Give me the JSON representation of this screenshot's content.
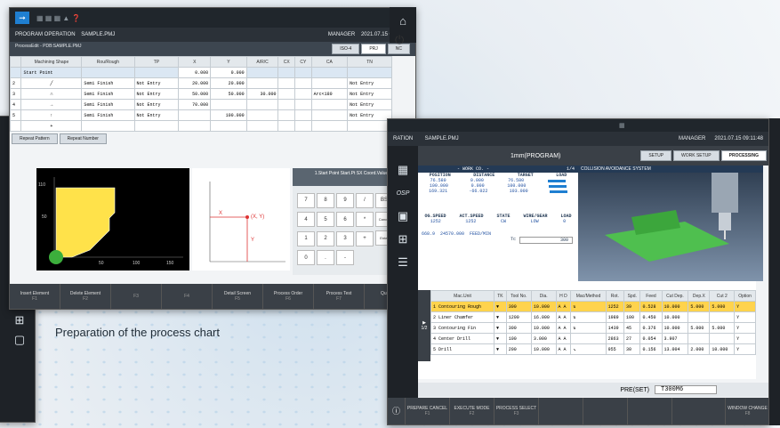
{
  "caption": "Preparation of the process chart",
  "win1": {
    "title": "PROGRAM OPERATION",
    "file": "SAMPLE.PMJ",
    "user": "MANAGER",
    "datetime": "2021.07.15 08:42:37",
    "process_label": "ProcessEdit - PDB:SAMPLE.PMJ",
    "tabs": [
      "ISO-4",
      "PRJ",
      "NC"
    ],
    "headers": [
      "Machining Shape",
      "Rou/Rough",
      "TP",
      "X",
      "Y",
      "A/R/C",
      "CX",
      "CY",
      "CA",
      "TN"
    ],
    "rows": [
      {
        "no": "",
        "shape": "Start Point",
        "rough": "",
        "tp": "",
        "x": "0.000",
        "y": "0.000",
        "a": "",
        "cx": "",
        "cy": "",
        "ca": "",
        "tn": ""
      },
      {
        "no": "2",
        "shape": "",
        "rough": "Semi Finish",
        "tp": "Not Entry",
        "x": "20.000",
        "y": "20.000",
        "a": "",
        "cx": "",
        "cy": "",
        "ca": "",
        "tn": "Not Entry"
      },
      {
        "no": "3",
        "shape": "",
        "rough": "Semi Finish",
        "tp": "Not Entry",
        "x": "50.000",
        "y": "50.000",
        "a": "30.000",
        "cx": "",
        "cy": "",
        "ca": "Arc<180",
        "tn": "Not Entry"
      },
      {
        "no": "4",
        "shape": "",
        "rough": "Semi Finish",
        "tp": "Not Entry",
        "x": "70.000",
        "y": "",
        "a": "",
        "cx": "",
        "cy": "",
        "ca": "",
        "tn": "Not Entry"
      },
      {
        "no": "5",
        "shape": "",
        "rough": "Semi Finish",
        "tp": "Not Entry",
        "x": "",
        "y": "100.000",
        "a": "",
        "cx": "",
        "cy": "",
        "ca": "",
        "tn": "Not Entry"
      }
    ],
    "repeat": [
      "Repeat Pattern",
      "Repeat Number"
    ],
    "axis_y": [
      "110",
      "50"
    ],
    "axis_x": [
      "50",
      "100",
      "150"
    ],
    "diagram": {
      "x": "X",
      "y": "Y",
      "xy": "(X, Y)"
    },
    "keypad_title": "1.Start Point Start.Pt SX Coord.Value",
    "keys": [
      "7",
      "8",
      "9",
      "/",
      "BS",
      "4",
      "5",
      "6",
      "*",
      "Cancel",
      "1",
      "2",
      "3",
      "+",
      "Enter",
      "0",
      ".",
      "-"
    ],
    "fkeys": [
      "Insert Element",
      "Delete Element",
      "",
      "",
      "Detail Screen",
      "Process Order",
      "Process Test",
      "Quit/Save"
    ],
    "fnums": [
      "F1",
      "F2",
      "F3",
      "F4",
      "F5",
      "F6",
      "F7",
      "F8"
    ]
  },
  "win2": {
    "title": "RATION",
    "file": "SAMPLE.PMJ",
    "user": "MANAGER",
    "datetime": "2021.07.15 09:11:48",
    "program": "1mm(PROGRAM)",
    "tabs": [
      "SETUP",
      "WORK SETUP",
      "PROCESSING"
    ],
    "work_co": "- WORK CO. -",
    "page": "1/4",
    "pos_headers": [
      "POSITION",
      "DISTANCE",
      "TARGET",
      "LOAD"
    ],
    "pos_rows": [
      [
        "76.580",
        "0.000",
        "76.580"
      ],
      [
        "100.000",
        "0.000",
        "100.000"
      ],
      [
        "169.321",
        "-66.022",
        "103.000"
      ]
    ],
    "spd_headers": [
      "OG.SPEED",
      "ACT.SPEED",
      "STATE",
      "WIRE/GEAR",
      "LOAD"
    ],
    "spd_row": [
      "1252",
      "1252",
      "CW",
      "LOW",
      "0"
    ],
    "feed": "668.9",
    "feed2": "24570.000",
    "feed_label": "FEED/MIN",
    "tc": "Tc",
    "tc_val": "300",
    "collision": "COLLISION AVOIDANCE SYSTEM",
    "tbl_headers": [
      "Mac.Unit",
      "TK",
      "Tool No.",
      "Dia.",
      "H D",
      "Mac/Method",
      "Rot.",
      "Spd.",
      "Feed",
      "Cut Dep.",
      "Dep.X",
      "Cut 1",
      "Dep.Z",
      "Cut 2",
      "Option"
    ],
    "tbl_rows": [
      [
        "1 Contouring Rough",
        "",
        "300",
        "10.000",
        "A A",
        "",
        "1252",
        "39",
        "0.528",
        "10.000",
        "5.000",
        "5.000"
      ],
      [
        "2 Liner Chamfer",
        "",
        "1200",
        "16.000",
        "A A",
        "",
        "1989",
        "100",
        "0.450",
        "10.000",
        "",
        ""
      ],
      [
        "3 Contouring Fin",
        "",
        "300",
        "10.000",
        "A A",
        "",
        "1439",
        "45",
        "0.376",
        "10.000",
        "5.000",
        "5.000"
      ],
      [
        "4 Center Drill",
        "",
        "100",
        "3.000",
        "A A",
        "",
        "2863",
        "27",
        "0.054",
        "3.907",
        "",
        ""
      ],
      [
        "5 Drill",
        "",
        "200",
        "10.000",
        "A A",
        "",
        "955",
        "30",
        "0.156",
        "13.004",
        "2.000",
        "10.000"
      ]
    ],
    "page_ind": "1/2",
    "pre_label": "PRE(SET)",
    "pre_value": "T300M6",
    "fkeys": [
      "PREPARE CANCEL",
      "EXECUTE MODE",
      "PROCESS SELECT",
      "",
      "",
      "",
      "",
      "WINDOW CHANGE"
    ],
    "fnums": [
      "F1",
      "F2",
      "F3",
      "",
      "",
      "",
      "",
      "F8"
    ]
  },
  "colors": {
    "accent": "#1f7fd1",
    "dark": "#20262c",
    "yellow": "#ffe24a",
    "green": "#3cae3c"
  }
}
